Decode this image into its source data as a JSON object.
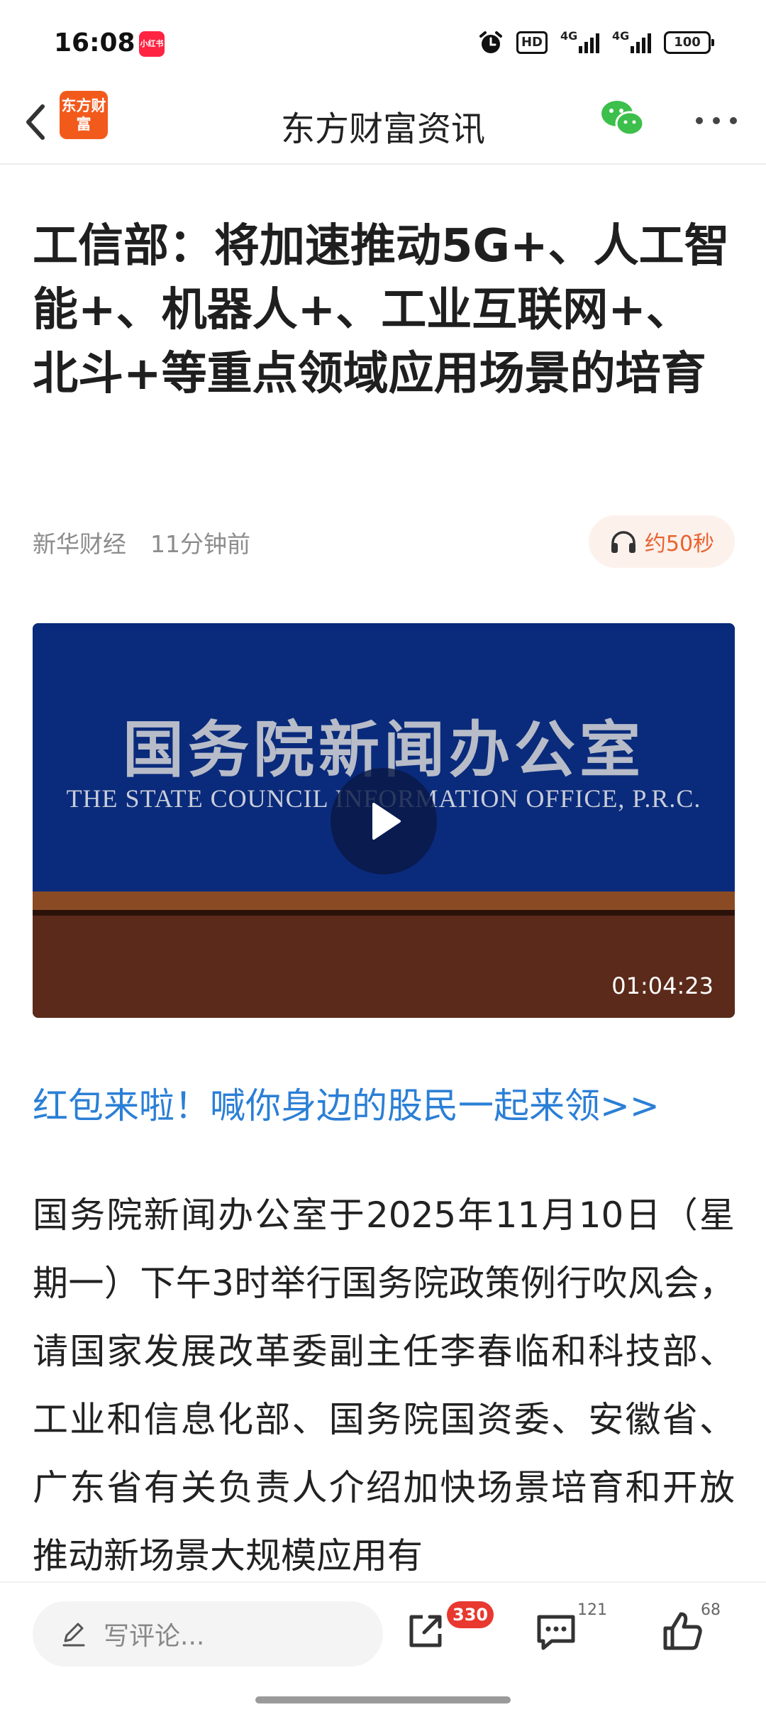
{
  "status_bar": {
    "time": "16:08",
    "app_badge": "小红书",
    "hd_label": "HD",
    "signal1_label": "4G",
    "signal2_label": "4G",
    "battery": "100"
  },
  "nav": {
    "title": "东方财富资讯",
    "logo_text": "东方财富",
    "icons": [
      "back-icon",
      "wechat-icon",
      "more-icon"
    ]
  },
  "article": {
    "headline": "工信部：将加速推动5G+、人工智能+、机器人+、工业互联网+、北斗+等重点领域应用场景的培育",
    "source": "新华财经",
    "time_ago": "11分钟前",
    "listen_label": "约50秒",
    "video": {
      "title_cn": "国务院新闻办公室",
      "title_en": "THE STATE COUNCIL INFORMATION OFFICE, P.R.C.",
      "duration": "01:04:23"
    },
    "promo_link": "红包来啦！喊你身边的股民一起来领>>",
    "body": "国务院新闻办公室于2025年11月10日（星期一）下午3时举行国务院政策例行吹风会，请国家发展改革委副主任李春临和科技部、工业和信息化部、国务院国资委、安徽省、广东省有关负责人介绍加快场景培育和开放推动新场景大规模应用有"
  },
  "bottom_bar": {
    "comment_placeholder": "写评论...",
    "share_count": "330",
    "comment_count": "121",
    "like_count": "68"
  },
  "colors": {
    "accent_orange": "#e8632f",
    "link_blue": "#2b7fd6",
    "badge_red": "#e8382f",
    "video_blue": "#0a2b7c",
    "video_brown": "#5b2a1a"
  }
}
